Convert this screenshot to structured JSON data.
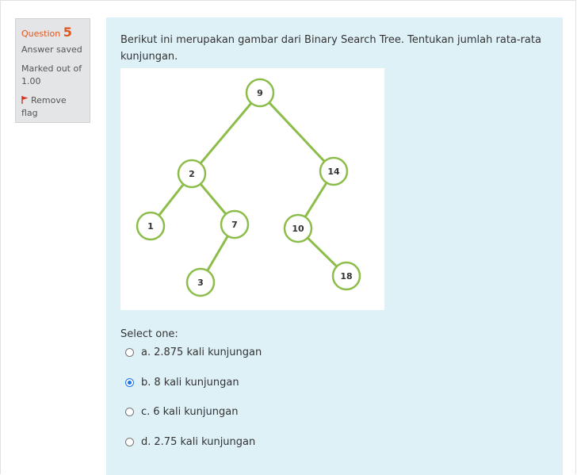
{
  "question": {
    "label": "Question",
    "number": "5",
    "state": "Answer saved",
    "grade": "Marked out of 1.00",
    "flag_label": "Remove flag",
    "text": "Berikut ini merupakan gambar dari Binary Search Tree. Tentukan jumlah rata-rata kunjungan.",
    "prompt": "Select one:",
    "options": [
      {
        "letter": "a.",
        "text": "2.875 kali kunjungan",
        "selected": false
      },
      {
        "letter": "b.",
        "text": "8 kali kunjungan",
        "selected": true
      },
      {
        "letter": "c.",
        "text": "6 kali kunjungan",
        "selected": false
      },
      {
        "letter": "d.",
        "text": "2.75 kali kunjungan",
        "selected": false
      }
    ]
  },
  "tree": {
    "nodes": [
      "9",
      "2",
      "14",
      "1",
      "7",
      "10",
      "3",
      "18"
    ],
    "edges": [
      [
        "9",
        "2"
      ],
      [
        "9",
        "14"
      ],
      [
        "2",
        "1"
      ],
      [
        "2",
        "7"
      ],
      [
        "14",
        "10"
      ],
      [
        "7",
        "3"
      ],
      [
        "10",
        "18"
      ]
    ]
  },
  "colors": {
    "accent": "#e0561f",
    "content_bg": "#def1f7",
    "edge": "#8cbd4a",
    "radio_selected": "#1a73e8"
  },
  "icons": {
    "flag": "flag-icon"
  }
}
